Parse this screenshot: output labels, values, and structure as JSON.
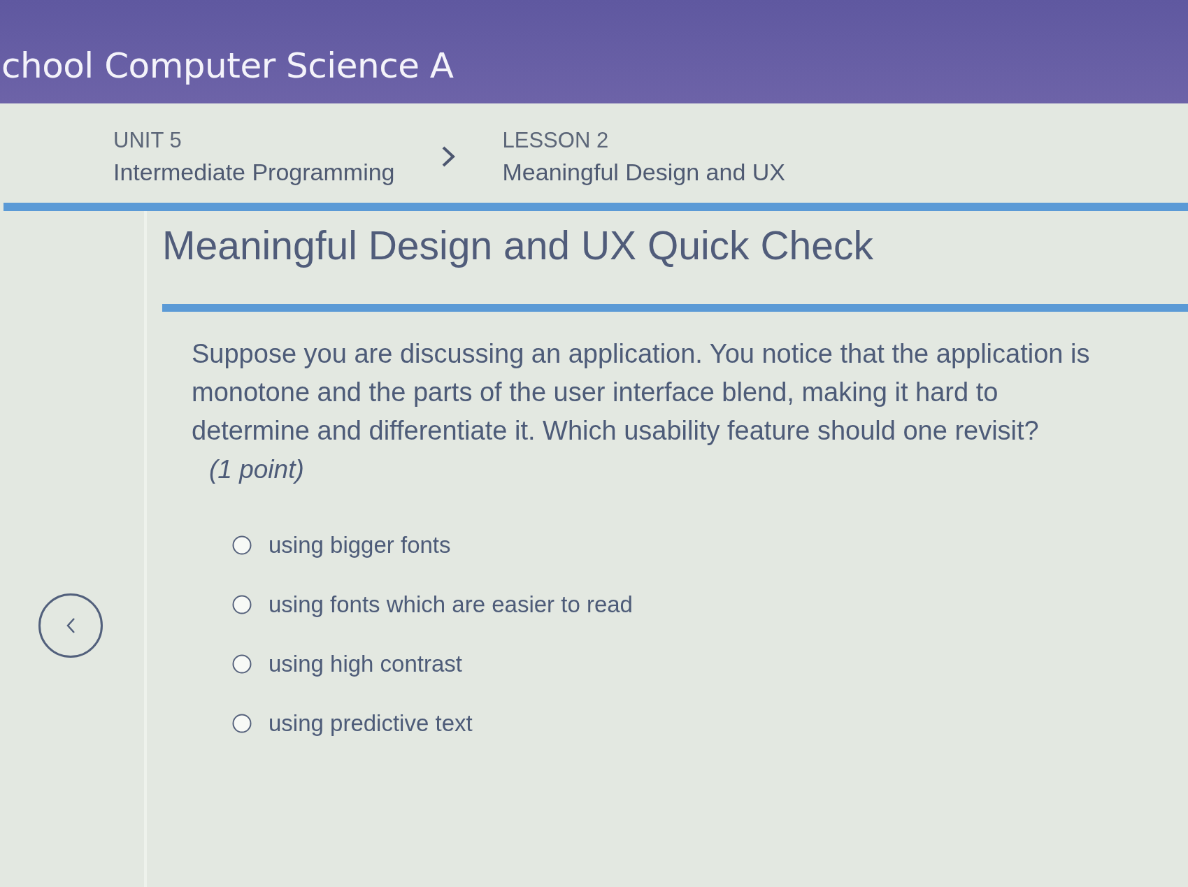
{
  "header": {
    "title": "chool Computer Science A"
  },
  "breadcrumb": [
    {
      "label": "UNIT 5",
      "name": "Intermediate Programming"
    },
    {
      "label": "LESSON 2",
      "name": "Meaningful Design and UX"
    }
  ],
  "page_title": "Meaningful Design and UX Quick Check",
  "question": {
    "text": "Suppose you are discussing an application. You notice that the application is monotone and the parts of the user interface blend, making it hard to determine and differentiate it. Which usability feature should one revisit?",
    "points": "(1 point)",
    "options": [
      {
        "label": "using bigger fonts",
        "selected": false
      },
      {
        "label": "using fonts which are easier to read",
        "selected": false
      },
      {
        "label": "using high contrast",
        "selected": false
      },
      {
        "label": "using predictive text",
        "selected": false
      }
    ]
  }
}
